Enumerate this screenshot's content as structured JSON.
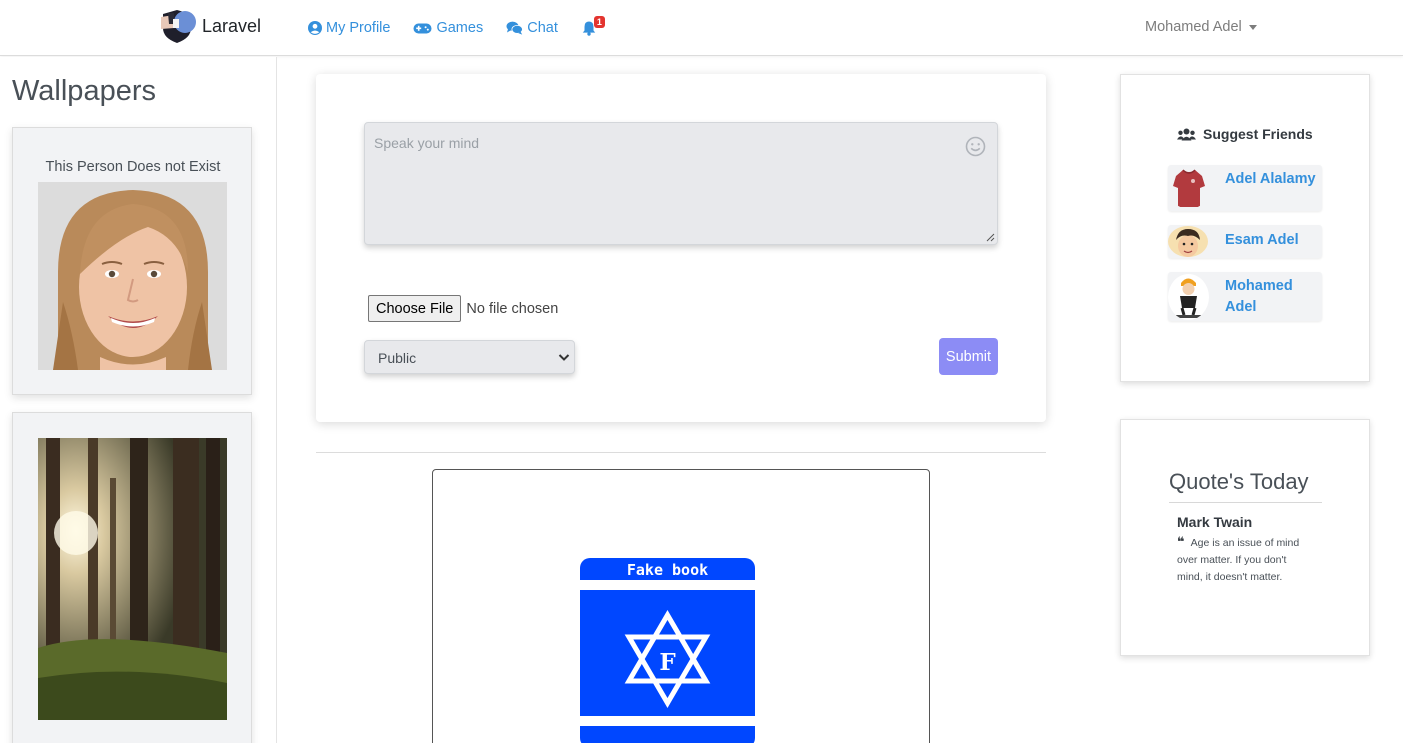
{
  "navbar": {
    "brand": "Laravel",
    "links": {
      "profile": "My Profile",
      "games": "Games",
      "chat": "Chat"
    },
    "notification_count": "1",
    "user_name": "Mohamed Adel"
  },
  "sidebar": {
    "title": "Wallpapers",
    "cards": [
      {
        "caption": "This Person Does not Exist"
      },
      {
        "caption": ""
      }
    ]
  },
  "composer": {
    "placeholder": "Speak your mind",
    "file_button": "Choose File",
    "file_status": "No file chosen",
    "privacy_selected": "Public",
    "submit_label": "Submit"
  },
  "feed": {
    "post_image_text": "Fake book",
    "post_image_letter": "F"
  },
  "suggest": {
    "title": "Suggest Friends",
    "friends": [
      {
        "name": "Adel Alalamy"
      },
      {
        "name": "Esam Adel"
      },
      {
        "name": "Mohamed Adel"
      }
    ]
  },
  "quote": {
    "title": "Quote's Today",
    "author": "Mark Twain",
    "text": "Age is an issue of mind over matter. If you don't mind, it doesn't matter."
  },
  "colors": {
    "link": "#3490dc",
    "submit": "#8c8cf5",
    "badge": "#e3342f",
    "fakebook_blue": "#0047ff"
  }
}
